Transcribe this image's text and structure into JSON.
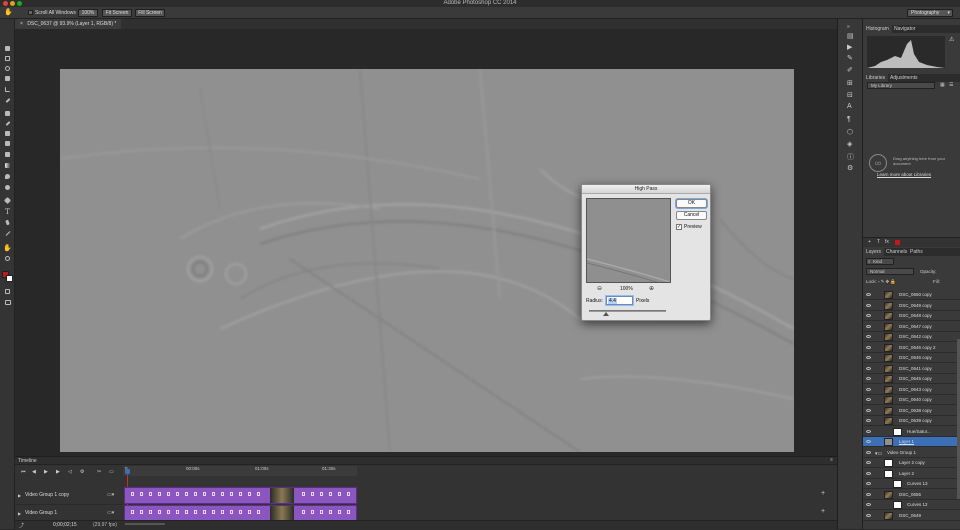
{
  "app": {
    "title": "Adobe Photoshop CC 2014"
  },
  "options_bar": {
    "scroll_all_label": "Scroll All Windows",
    "zoom_100": "100%",
    "fit_screen": "Fit Screen",
    "fill_screen": "Fill Screen",
    "workspace": "Photography"
  },
  "document": {
    "tab_title": "DSC_0637 @ 93.9% (Layer 1, RGB/8) *"
  },
  "high_pass": {
    "title": "High Pass",
    "ok": "OK",
    "cancel": "Cancel",
    "preview_label": "Preview",
    "preview_checked": true,
    "zoom": "100%",
    "radius_label": "Radius:",
    "radius_value": "4.4",
    "radius_unit": "Pixels",
    "slider_fraction": 0.22
  },
  "timeline": {
    "title": "Timeline",
    "timecodes": [
      "00:00s",
      "01:00s",
      "01:30s"
    ],
    "current_time": "0;00;02;15",
    "fps": "(29.97 fps)",
    "tracks": [
      "Video Group 1 copy",
      "Video Group 1"
    ]
  },
  "histogram": {
    "tabs": [
      "Histogram",
      "Navigator"
    ]
  },
  "libraries": {
    "tabs": [
      "Libraries",
      "Adjustments"
    ],
    "library_select": "My Library",
    "empty_text": "Drag anything here from your document",
    "learn_more": "Learn more about Libraries"
  },
  "layers": {
    "tabs": [
      "Layers",
      "Channels",
      "Paths"
    ],
    "kind_filter": "Kind",
    "blend_mode": "Normal",
    "opacity_label": "Opacity:",
    "lock_label": "Lock:",
    "fill_label": "Fill:",
    "items": [
      {
        "name": "DSC_0650 copy",
        "type": "image",
        "indent": 1
      },
      {
        "name": "DSC_0649 copy",
        "type": "image",
        "indent": 1
      },
      {
        "name": "DSC_0648 copy",
        "type": "image",
        "indent": 1
      },
      {
        "name": "DSC_0647 copy",
        "type": "image",
        "indent": 1
      },
      {
        "name": "DSC_0642 copy",
        "type": "image",
        "indent": 1
      },
      {
        "name": "DSC_0646 copy 2",
        "type": "image",
        "indent": 1
      },
      {
        "name": "DSC_0646 copy",
        "type": "image",
        "indent": 1
      },
      {
        "name": "DSC_0641 copy",
        "type": "image",
        "indent": 1
      },
      {
        "name": "DSC_0645 copy",
        "type": "image",
        "indent": 1
      },
      {
        "name": "DSC_0643 copy",
        "type": "image",
        "indent": 1
      },
      {
        "name": "DSC_0640 copy",
        "type": "image",
        "indent": 1
      },
      {
        "name": "DSC_0638 copy",
        "type": "image",
        "indent": 1
      },
      {
        "name": "DSC_0639 copy",
        "type": "image",
        "indent": 1
      },
      {
        "name": "Hue/Satur...",
        "type": "adjustment",
        "indent": 2
      },
      {
        "name": "Layer 1",
        "type": "gray",
        "indent": 1,
        "selected": true
      },
      {
        "name": "Video Group 1",
        "type": "group",
        "indent": 0
      },
      {
        "name": "Layer 2 copy",
        "type": "white",
        "indent": 1
      },
      {
        "name": "Layer 2",
        "type": "white",
        "indent": 1
      },
      {
        "name": "Curves 13",
        "type": "adjustment",
        "indent": 2
      },
      {
        "name": "DSC_0655",
        "type": "image",
        "indent": 1
      },
      {
        "name": "Curves 12",
        "type": "adjustment",
        "indent": 2
      },
      {
        "name": "DSC_0649",
        "type": "image",
        "indent": 1
      }
    ]
  },
  "colors": {
    "accent": "#3b6fb6",
    "clip": "#8c56c0",
    "foreground": "#c4161c",
    "background": "#ffffff"
  }
}
